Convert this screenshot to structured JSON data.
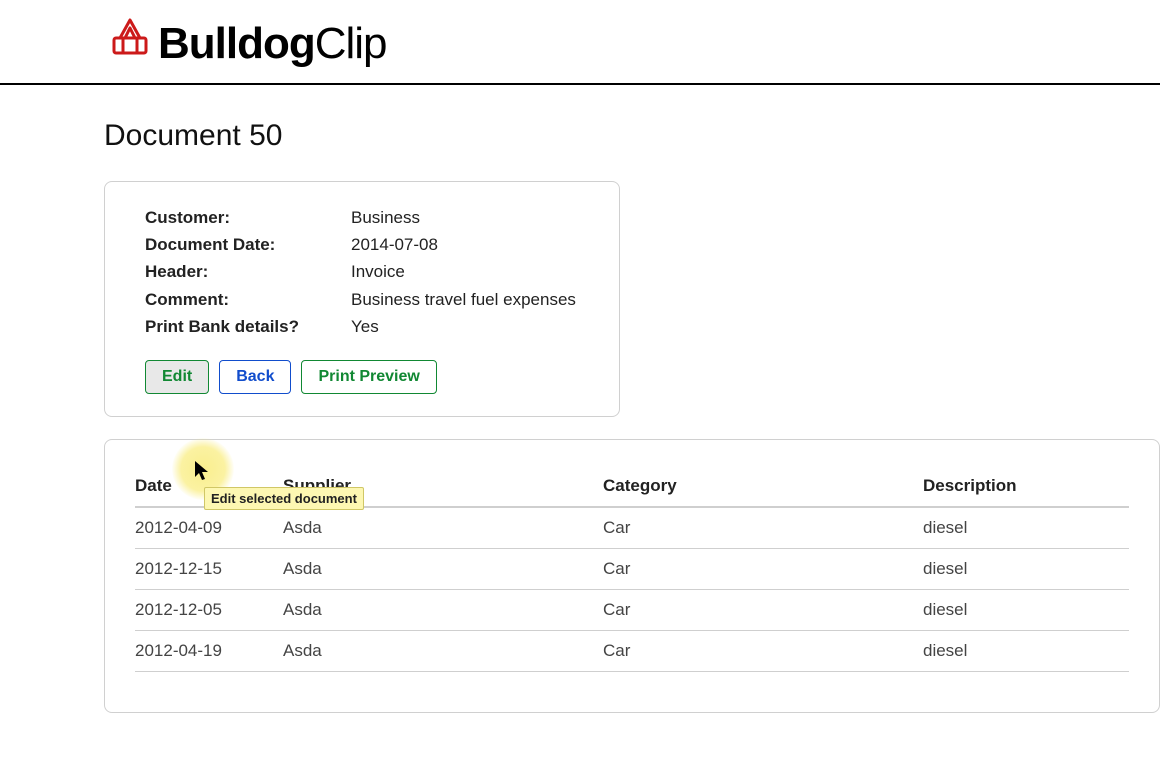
{
  "brand": {
    "bold": "Bulldog",
    "thin": "Clip"
  },
  "page_title": "Document 50",
  "details": {
    "fields": [
      {
        "key": "Customer:",
        "value": "Business"
      },
      {
        "key": "Document Date:",
        "value": "2014-07-08"
      },
      {
        "key": "Header:",
        "value": "Invoice"
      },
      {
        "key": "Comment:",
        "value": "Business travel fuel expenses"
      },
      {
        "key": "Print Bank details?",
        "value": "Yes"
      }
    ],
    "buttons": {
      "edit": "Edit",
      "back": "Back",
      "preview": "Print Preview"
    }
  },
  "tooltip": "Edit selected document",
  "table": {
    "headers": {
      "date": "Date",
      "supplier": "Supplier",
      "category": "Category",
      "description": "Description"
    },
    "rows": [
      {
        "date": "2012-04-09",
        "supplier": "Asda",
        "category": "Car",
        "description": "diesel"
      },
      {
        "date": "2012-12-15",
        "supplier": "Asda",
        "category": "Car",
        "description": "diesel"
      },
      {
        "date": "2012-12-05",
        "supplier": "Asda",
        "category": "Car",
        "description": "diesel"
      },
      {
        "date": "2012-04-19",
        "supplier": "Asda",
        "category": "Car",
        "description": "diesel"
      }
    ]
  }
}
